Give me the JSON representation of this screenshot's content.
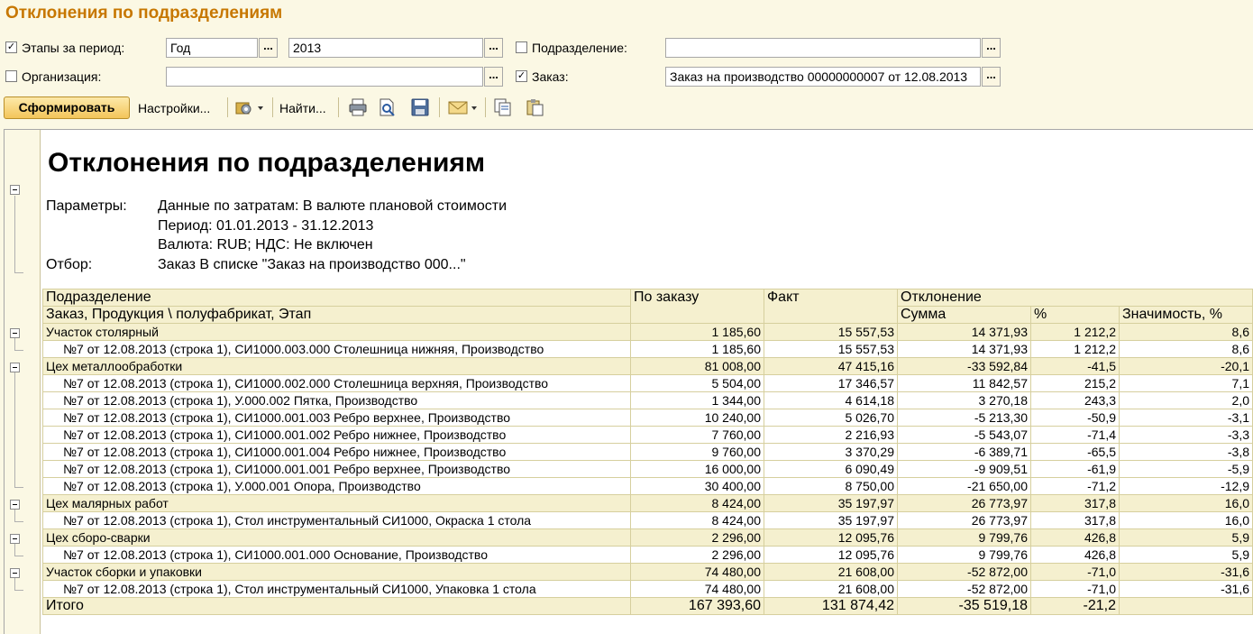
{
  "window": {
    "title": "Отклонения по подразделениям"
  },
  "filters": {
    "stages": {
      "label": "Этапы за период:",
      "checked": true,
      "period_type": "Год",
      "year": "2013"
    },
    "department": {
      "label": "Подразделение:",
      "checked": false,
      "value": ""
    },
    "organization": {
      "label": "Организация:",
      "checked": false,
      "value": ""
    },
    "order": {
      "label": "Заказ:",
      "checked": true,
      "value": "Заказ на производство 00000000007 от 12.08.2013"
    },
    "dots": "..."
  },
  "toolbar": {
    "generate_label": "Сформировать",
    "settings_label": "Настройки...",
    "find_label": "Найти...",
    "icons": [
      "settings-icon",
      "print-icon",
      "preview-icon",
      "save-icon",
      "mail-icon",
      "copy-icon",
      "paste-icon"
    ]
  },
  "report": {
    "title": "Отклонения по подразделениям",
    "params_label": "Параметры:",
    "params": [
      "Данные по затратам: В валюте плановой стоимости",
      "Период: 01.01.2013 - 31.12.2013",
      "Валюта: RUB; НДС: Не включен"
    ],
    "filter_label": "Отбор:",
    "filter_value": "Заказ В списке \"Заказ на производство 000...\"",
    "columns": {
      "department": "Подразделение",
      "sub": "Заказ, Продукция \\ полуфабрикат, Этап",
      "by_order": "По заказу",
      "fact": "Факт",
      "deviation": "Отклонение",
      "sum": "Сумма",
      "percent": "%",
      "significance": "Значимость, %"
    },
    "rows": [
      {
        "level": 0,
        "name": "Участок столярный",
        "by_order": "1 185,60",
        "fact": "15 557,53",
        "sum": "14 371,93",
        "percent": "1 212,2",
        "significance": "8,6"
      },
      {
        "level": 1,
        "name": "№7 от 12.08.2013 (строка 1), СИ1000.003.000 Столешница нижняя, Производство",
        "by_order": "1 185,60",
        "fact": "15 557,53",
        "sum": "14 371,93",
        "percent": "1 212,2",
        "significance": "8,6"
      },
      {
        "level": 0,
        "name": "Цех металлообработки",
        "by_order": "81 008,00",
        "fact": "47 415,16",
        "sum": "-33 592,84",
        "percent": "-41,5",
        "significance": "-20,1"
      },
      {
        "level": 1,
        "name": "№7 от 12.08.2013 (строка 1), СИ1000.002.000 Столешница верхняя, Производство",
        "by_order": "5 504,00",
        "fact": "17 346,57",
        "sum": "11 842,57",
        "percent": "215,2",
        "significance": "7,1"
      },
      {
        "level": 1,
        "name": "№7 от 12.08.2013 (строка 1), У.000.002 Пятка, Производство",
        "by_order": "1 344,00",
        "fact": "4 614,18",
        "sum": "3 270,18",
        "percent": "243,3",
        "significance": "2,0"
      },
      {
        "level": 1,
        "name": "№7 от 12.08.2013 (строка 1), СИ1000.001.003 Ребро верхнее, Производство",
        "by_order": "10 240,00",
        "fact": "5 026,70",
        "sum": "-5 213,30",
        "percent": "-50,9",
        "significance": "-3,1"
      },
      {
        "level": 1,
        "name": "№7 от 12.08.2013 (строка 1), СИ1000.001.002 Ребро нижнее, Производство",
        "by_order": "7 760,00",
        "fact": "2 216,93",
        "sum": "-5 543,07",
        "percent": "-71,4",
        "significance": "-3,3"
      },
      {
        "level": 1,
        "name": "№7 от 12.08.2013 (строка 1), СИ1000.001.004 Ребро нижнее, Производство",
        "by_order": "9 760,00",
        "fact": "3 370,29",
        "sum": "-6 389,71",
        "percent": "-65,5",
        "significance": "-3,8"
      },
      {
        "level": 1,
        "name": "№7 от 12.08.2013 (строка 1), СИ1000.001.001 Ребро верхнее, Производство",
        "by_order": "16 000,00",
        "fact": "6 090,49",
        "sum": "-9 909,51",
        "percent": "-61,9",
        "significance": "-5,9"
      },
      {
        "level": 1,
        "name": "№7 от 12.08.2013 (строка 1), У.000.001 Опора, Производство",
        "by_order": "30 400,00",
        "fact": "8 750,00",
        "sum": "-21 650,00",
        "percent": "-71,2",
        "significance": "-12,9"
      },
      {
        "level": 0,
        "name": "Цех малярных работ",
        "by_order": "8 424,00",
        "fact": "35 197,97",
        "sum": "26 773,97",
        "percent": "317,8",
        "significance": "16,0"
      },
      {
        "level": 1,
        "name": "№7 от 12.08.2013 (строка 1), Стол инструментальный СИ1000, Окраска 1 стола",
        "by_order": "8 424,00",
        "fact": "35 197,97",
        "sum": "26 773,97",
        "percent": "317,8",
        "significance": "16,0"
      },
      {
        "level": 0,
        "name": "Цех сборо-сварки",
        "by_order": "2 296,00",
        "fact": "12 095,76",
        "sum": "9 799,76",
        "percent": "426,8",
        "significance": "5,9"
      },
      {
        "level": 1,
        "name": "№7 от 12.08.2013 (строка 1), СИ1000.001.000 Основание, Производство",
        "by_order": "2 296,00",
        "fact": "12 095,76",
        "sum": "9 799,76",
        "percent": "426,8",
        "significance": "5,9"
      },
      {
        "level": 0,
        "name": "Участок сборки и упаковки",
        "by_order": "74 480,00",
        "fact": "21 608,00",
        "sum": "-52 872,00",
        "percent": "-71,0",
        "significance": "-31,6"
      },
      {
        "level": 1,
        "name": "№7 от 12.08.2013 (строка 1), Стол инструментальный СИ1000, Упаковка 1 стола",
        "by_order": "74 480,00",
        "fact": "21 608,00",
        "sum": "-52 872,00",
        "percent": "-71,0",
        "significance": "-31,6"
      }
    ],
    "total": {
      "label": "Итого",
      "by_order": "167 393,60",
      "fact": "131 874,42",
      "sum": "-35 519,18",
      "percent": "-21,2",
      "significance": ""
    }
  }
}
